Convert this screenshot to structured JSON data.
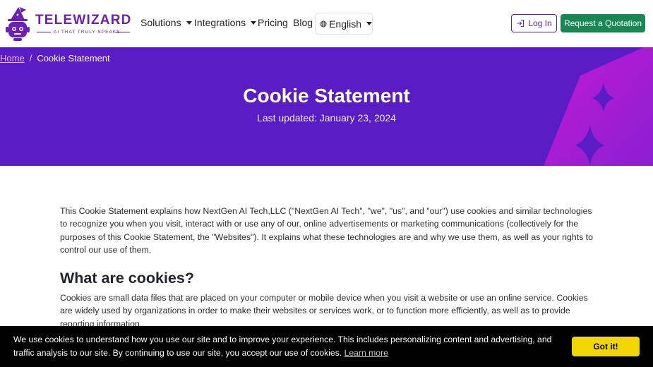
{
  "brand": {
    "name": "TELEWIZARD",
    "tagline": "AI THAT TRULY SPEAKS",
    "logo_icon": "wizard-robot-icon",
    "color": "#6a1fb8"
  },
  "nav": {
    "solutions": "Solutions",
    "integrations": "Integrations",
    "pricing": "Pricing",
    "blog": "Blog",
    "language": "English",
    "login": "Log In",
    "quote": "Request a Quotation"
  },
  "breadcrumb": {
    "home": "Home",
    "separator": "/",
    "current": "Cookie Statement"
  },
  "hero": {
    "title": "Cookie Statement",
    "updated": "Last updated: January 23, 2024",
    "background": "#5a1cc4"
  },
  "content": {
    "intro": "This Cookie Statement explains how NextGen AI Tech,LLC (\"NextGen AI Tech\", \"we\", \"us\", and \"our\") use cookies and similar technologies to recognize you when you visit, interact with or use any of our, online advertisements or marketing communications (collectively for the purposes of this Cookie Statement, the \"Websites\"). It explains what these technologies are and why we use them, as well as your rights to control our use of them.",
    "section_heading": "What are cookies?",
    "section_text": "Cookies are small data files that are placed on your computer or mobile device when you visit a website or use an online service. Cookies are widely used by organizations in order to make their websites or services work, or to function more efficiently, as well as to provide reporting information."
  },
  "cookie_banner": {
    "message": "We use cookies to understand how you use our site and to improve your experience. This includes personalizing content and advertising, and traffic analysis to our site. By continuing to use our site, you accept our use of cookies.",
    "learn_more": "Learn more",
    "accept": "Got it!",
    "accent": "#f1d600"
  }
}
